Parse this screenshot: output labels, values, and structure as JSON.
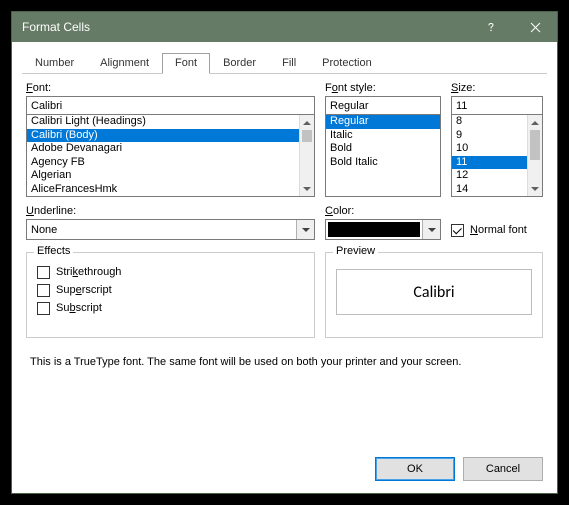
{
  "window": {
    "title": "Format Cells"
  },
  "tabs": [
    "Number",
    "Alignment",
    "Font",
    "Border",
    "Fill",
    "Protection"
  ],
  "active_tab": "Font",
  "font": {
    "label": "Font:",
    "value": "Calibri",
    "items": [
      "Calibri Light (Headings)",
      "Calibri (Body)",
      "Adobe Devanagari",
      "Agency FB",
      "Algerian",
      "AliceFrancesHmk"
    ],
    "selected_index": 1
  },
  "style": {
    "label": "Font style:",
    "value": "Regular",
    "items": [
      "Regular",
      "Italic",
      "Bold",
      "Bold Italic"
    ],
    "selected_index": 0
  },
  "size": {
    "label": "Size:",
    "value": "11",
    "items": [
      "8",
      "9",
      "10",
      "11",
      "12",
      "14"
    ],
    "selected_index": 3
  },
  "underline": {
    "label": "Underline:",
    "value": "None"
  },
  "color": {
    "label": "Color:",
    "value": "#000000"
  },
  "normal_font": {
    "label": "Normal font",
    "checked": true
  },
  "effects": {
    "legend": "Effects",
    "strikethrough": {
      "label": "Strikethrough",
      "checked": false
    },
    "superscript": {
      "label": "Superscript",
      "checked": false
    },
    "subscript": {
      "label": "Subscript",
      "checked": false
    }
  },
  "preview": {
    "legend": "Preview",
    "text": "Calibri"
  },
  "footnote": "This is a TrueType font.  The same font will be used on both your printer and your screen.",
  "buttons": {
    "ok": "OK",
    "cancel": "Cancel"
  }
}
